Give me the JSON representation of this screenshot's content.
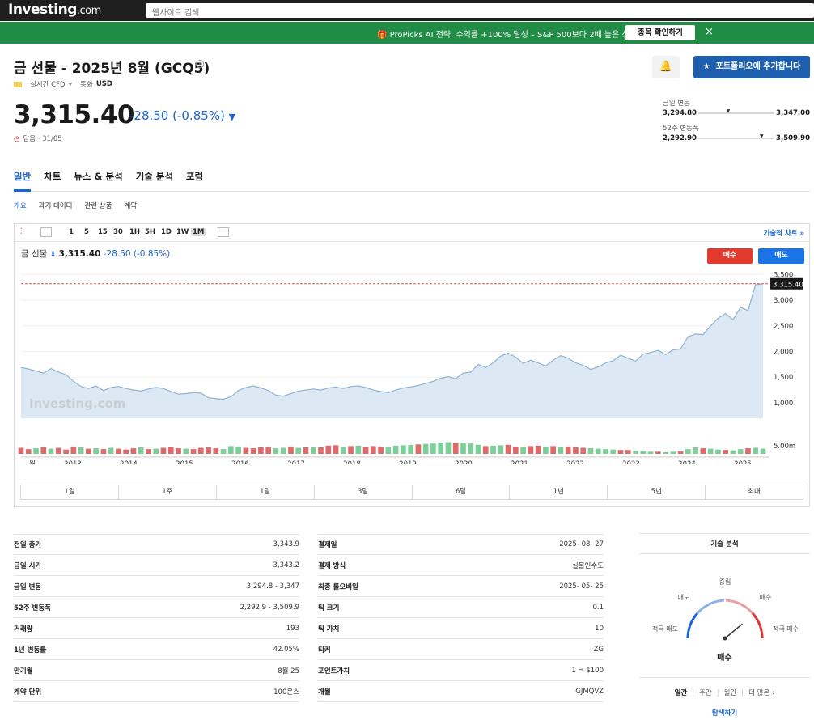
{
  "header": {
    "logo": "Investing",
    "logo_suffix": ".com",
    "search_placeholder": "웹사이트 검색"
  },
  "banner": {
    "text": "🎁 ProPicks AI 전략, 수익률 +100% 달성 – S&P 500보다 2배 높은 성과",
    "button": "종목 확인하기",
    "close": "×"
  },
  "instrument": {
    "title": "금 선물 - 2025년 8월 (GCQ5)",
    "info_icon": "i",
    "type": "실시간 CFD",
    "currency_label": "통화",
    "currency": "USD",
    "price": "3,315.40",
    "change": "-28.50 (-0.85%)",
    "status": "닫음 · 31/05"
  },
  "actions": {
    "portfolio_button": "포트폴리오에 추가합니다",
    "alert_icon": "bell-plus-icon"
  },
  "ranges": {
    "day": {
      "label": "금일 변동",
      "low": "3,294.80",
      "high": "3,347.00",
      "position": 0.4
    },
    "year": {
      "label": "52주 변동폭",
      "low": "2,292.90",
      "high": "3,509.90",
      "position": 0.84
    }
  },
  "tabs": [
    "일반",
    "차트",
    "뉴스 & 분석",
    "기술 분석",
    "포럼"
  ],
  "subtabs": [
    "개요",
    "과거 데이터",
    "관련 상품",
    "계약"
  ],
  "chart_toolbar": {
    "timeframes": [
      "1",
      "5",
      "15",
      "30",
      "1H",
      "5H",
      "1D",
      "1W",
      "1M"
    ],
    "active_timeframe": "1M",
    "tech_chart_link": "기술적 차트 »"
  },
  "chart_legend": {
    "name": "금 선물",
    "price": "3,315.40",
    "change": "-28.50 (-0.85%)"
  },
  "trade_buttons": {
    "buy": "매수",
    "sell": "매도"
  },
  "range_buttons": [
    "1일",
    "1주",
    "1달",
    "3달",
    "6달",
    "1년",
    "5년",
    "최대"
  ],
  "chart_data": {
    "type": "area",
    "x_start_label": "월",
    "x_labels": [
      "2013",
      "2014",
      "2015",
      "2016",
      "2017",
      "2018",
      "2019",
      "2020",
      "2021",
      "2022",
      "2023",
      "2024",
      "2025"
    ],
    "y_ticks": [
      "3,500",
      "3,000",
      "2,500",
      "2,000",
      "1,500",
      "1,000"
    ],
    "volume_label": "5.00m",
    "last_price_label": "3,315.40",
    "watermark": "Investing.com",
    "ylim": [
      700,
      3600
    ],
    "series": [
      {
        "values": [
          1690,
          1660,
          1620,
          1580,
          1670,
          1600,
          1550,
          1420,
          1320,
          1280,
          1330,
          1240,
          1300,
          1320,
          1280,
          1250,
          1230,
          1270,
          1300,
          1280,
          1220,
          1170,
          1180,
          1200,
          1190,
          1100,
          1080,
          1070,
          1120,
          1240,
          1300,
          1330,
          1290,
          1240,
          1150,
          1130,
          1180,
          1230,
          1250,
          1270,
          1250,
          1290,
          1310,
          1280,
          1320,
          1330,
          1300,
          1250,
          1220,
          1200,
          1250,
          1290,
          1310,
          1340,
          1380,
          1420,
          1480,
          1510,
          1470,
          1580,
          1600,
          1750,
          1690,
          1780,
          1910,
          1970,
          1890,
          1770,
          1830,
          1780,
          1720,
          1830,
          1920,
          1870,
          1780,
          1730,
          1650,
          1700,
          1780,
          1820,
          1930,
          1870,
          1810,
          1950,
          1980,
          2020,
          1940,
          2030,
          2050,
          2290,
          2340,
          2330,
          2500,
          2650,
          2740,
          2620,
          2860,
          2800,
          3300,
          3320
        ],
        "volumes": [
          1.4,
          1.1,
          1.3,
          1.6,
          1.2,
          1.4,
          1.0,
          1.7,
          1.5,
          1.2,
          1.3,
          1.1,
          1.4,
          1.2,
          1.0,
          1.3,
          1.5,
          1.1,
          1.2,
          1.4,
          1.6,
          1.3,
          1.2,
          1.1,
          1.4,
          1.5,
          1.3,
          1.1,
          1.8,
          1.7,
          1.4,
          1.3,
          1.5,
          1.6,
          1.3,
          1.4,
          1.7,
          1.4,
          1.5,
          1.6,
          1.5,
          1.9,
          2.0,
          1.6,
          1.8,
          1.9,
          1.6,
          1.8,
          1.7,
          1.6,
          1.9,
          2.0,
          2.1,
          2.2,
          2.3,
          2.4,
          2.6,
          2.7,
          2.5,
          2.6,
          2.4,
          2.1,
          1.8,
          1.9,
          2.0,
          2.1,
          1.7,
          1.6,
          1.8,
          1.9,
          1.7,
          1.8,
          1.6,
          1.7,
          1.5,
          1.4,
          1.3,
          1.2,
          1.1,
          1.0,
          0.9,
          0.9,
          0.7,
          0.6,
          0.5,
          0.5,
          0.4,
          0.5,
          0.6,
          1.1,
          1.5,
          1.3,
          1.2,
          1.0,
          0.9,
          0.8,
          1.1,
          1.3,
          1.4,
          1.2
        ],
        "volume_colors": [
          "red",
          "red",
          "green",
          "red",
          "green",
          "red",
          "red",
          "red",
          "green",
          "red",
          "green",
          "red",
          "green",
          "red",
          "red",
          "red",
          "green",
          "red",
          "green",
          "red",
          "red",
          "red",
          "green",
          "red",
          "red",
          "red",
          "red",
          "green",
          "green",
          "green",
          "red",
          "red",
          "red",
          "red",
          "green",
          "green",
          "red",
          "green",
          "red",
          "green",
          "red",
          "red",
          "red",
          "green",
          "red",
          "green",
          "red",
          "red",
          "red",
          "green",
          "green",
          "green",
          "green",
          "red",
          "green",
          "green",
          "green",
          "green",
          "red",
          "green",
          "green",
          "green",
          "red",
          "green",
          "green",
          "red",
          "red",
          "green",
          "red",
          "red",
          "green",
          "red",
          "green",
          "red",
          "red",
          "red",
          "green",
          "green",
          "green",
          "green",
          "red",
          "red",
          "green",
          "green",
          "green",
          "red",
          "green",
          "green",
          "red",
          "green",
          "green",
          "red",
          "green",
          "green",
          "red",
          "green",
          "green",
          "red",
          "green",
          "green"
        ]
      }
    ],
    "colors": {
      "line": "#8fb2d4",
      "fill": "#dce9f5",
      "up_volume": "#7dcf9a",
      "down_volume": "#e06a6a",
      "last_price": "#e05050"
    }
  },
  "stats_left": [
    {
      "k": "전일 종가",
      "v": "3,343.9"
    },
    {
      "k": "금일 시가",
      "v": "3,343.2"
    },
    {
      "k": "금일 변동",
      "v": "3,294.8 - 3,347"
    },
    {
      "k": "52주 변동폭",
      "v": "2,292.9 - 3,509.9"
    },
    {
      "k": "거래량",
      "v": "193"
    },
    {
      "k": "1년 변동률",
      "v": "42.05%"
    },
    {
      "k": "만기월",
      "v": "8월 25"
    },
    {
      "k": "계약 단위",
      "v": "100온스"
    }
  ],
  "stats_right": [
    {
      "k": "결제일",
      "v": "2025- 08- 27"
    },
    {
      "k": "결제 방식",
      "v": "실물인수도"
    },
    {
      "k": "최종 롤오버일",
      "v": "2025- 05- 25"
    },
    {
      "k": "틱 크기",
      "v": "0.1"
    },
    {
      "k": "틱 가치",
      "v": "10"
    },
    {
      "k": "티커",
      "v": "ZG"
    },
    {
      "k": "포인트가치",
      "v": "1 = $100"
    },
    {
      "k": "개월",
      "v": "GJMQVZ"
    }
  ],
  "technical": {
    "title": "기술 분석",
    "gauge_labels": {
      "strong_sell": "적극 매도",
      "sell": "매도",
      "neutral": "중립",
      "buy": "매수",
      "strong_buy": "적극 매수"
    },
    "gauge_value": 0.78,
    "verdict": "매수",
    "periods": [
      "일간",
      "주간",
      "월간",
      "더 많은 ›"
    ],
    "active_period": "일간",
    "more_link": "탐색하기"
  }
}
